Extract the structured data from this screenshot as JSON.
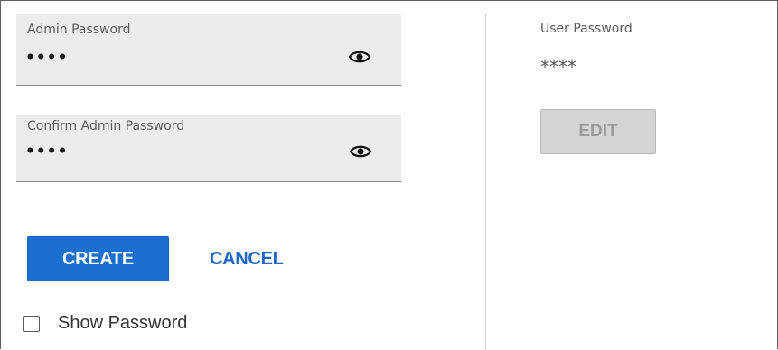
{
  "admin_password": {
    "label": "Admin Password",
    "value": "••••",
    "toggle_icon": "eye-icon"
  },
  "confirm_admin_password": {
    "label": "Confirm Admin Password",
    "value": "••••",
    "toggle_icon": "eye-icon"
  },
  "actions": {
    "create_label": "CREATE",
    "cancel_label": "CANCEL"
  },
  "show_password": {
    "label": "Show Password",
    "checked": false
  },
  "user_password": {
    "label": "User Password",
    "value": "****",
    "edit_label": "EDIT",
    "edit_enabled": false
  },
  "colors": {
    "primary": "#1a6fd1",
    "link": "#1f66c6",
    "field_background": "#ececec",
    "disabled_button": "#d4d4d4"
  }
}
